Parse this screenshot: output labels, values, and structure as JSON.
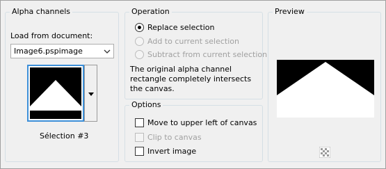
{
  "alpha": {
    "group_title": "Alpha channels",
    "load_label": "Load from document:",
    "document_value": "Image6.pspimage",
    "selection_caption": "Sélection #3"
  },
  "operation": {
    "group_title": "Operation",
    "options": [
      {
        "label": "Replace selection",
        "checked": true,
        "enabled": true
      },
      {
        "label": "Add to current selection",
        "checked": false,
        "enabled": false
      },
      {
        "label": "Subtract from current selection",
        "checked": false,
        "enabled": false
      }
    ],
    "info_text": "The original alpha channel rectangle completely intersects the canvas."
  },
  "options": {
    "group_title": "Options",
    "move_label": "Move to upper left of canvas",
    "clip_label": "Clip to canvas",
    "invert_label": "Invert image"
  },
  "preview": {
    "group_title": "Preview"
  },
  "icons": {
    "combo_arrow": "chevron-down-icon",
    "dropdown_arrow": "triangle-down-icon",
    "preview_toggle": "checkerboard-icon"
  },
  "colors": {
    "selection_border": "#3c8fd8",
    "group_border": "#d5dfe5",
    "disabled_text": "#a0a0a0"
  }
}
